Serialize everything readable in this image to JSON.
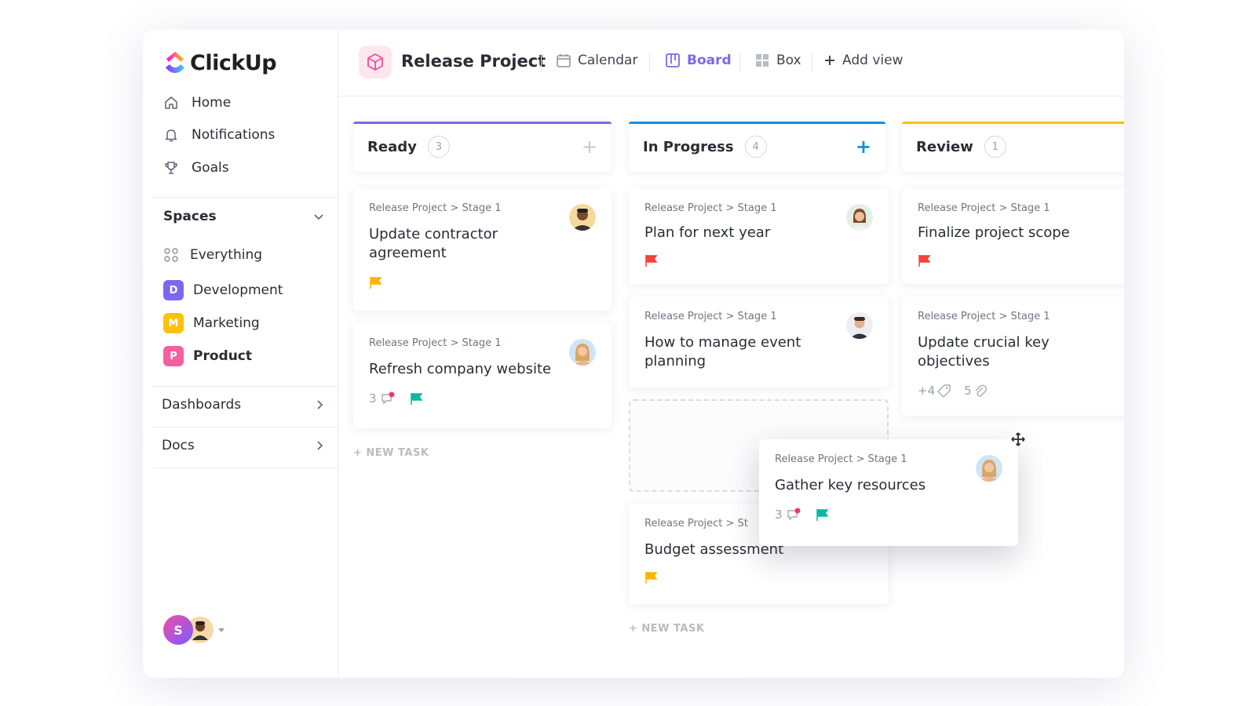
{
  "app": {
    "logo_text": "ClickUp"
  },
  "sidebar": {
    "nav": [
      {
        "label": "Home",
        "icon": "home-icon"
      },
      {
        "label": "Notifications",
        "icon": "bell-icon"
      },
      {
        "label": "Goals",
        "icon": "trophy-icon"
      }
    ],
    "spaces_label": "Spaces",
    "everything_label": "Everything",
    "spaces": [
      {
        "letter": "D",
        "label": "Development",
        "color": "#7b68ee"
      },
      {
        "letter": "M",
        "label": "Marketing",
        "color": "#ffc107"
      },
      {
        "letter": "P",
        "label": "Product",
        "color": "#f45fa0"
      }
    ],
    "dashboards_label": "Dashboards",
    "docs_label": "Docs",
    "user_initial": "S"
  },
  "topbar": {
    "project_title": "Release Project",
    "views": [
      {
        "label": "Calendar",
        "icon": "calendar-icon",
        "active": false
      },
      {
        "label": "Board",
        "icon": "board-icon",
        "active": true
      },
      {
        "label": "Box",
        "icon": "box-icon",
        "active": false
      }
    ],
    "add_view_label": "Add view"
  },
  "columns": [
    {
      "title": "Ready",
      "count": "3",
      "color": "#7b68ee"
    },
    {
      "title": "In Progress",
      "count": "4",
      "color": "#1090e0"
    },
    {
      "title": "Review",
      "count": "1",
      "color": "#ffc107"
    }
  ],
  "cards": {
    "ready": [
      {
        "path": "Release Project > Stage 1",
        "title": "Update contractor agreement",
        "flag": "#ffb300"
      },
      {
        "path": "Release Project > Stage 1",
        "title": "Refresh company website",
        "comments": "3",
        "flag": "#0fb5a6"
      }
    ],
    "in_progress": [
      {
        "path": "Release Project > Stage 1",
        "title": "Plan for next year",
        "flag": "#f44336"
      },
      {
        "path": "Release Project > Stage 1",
        "title": "How to manage event planning"
      },
      {
        "path": "Release Project > St",
        "title": "Budget assessment",
        "flag": "#ffb300"
      }
    ],
    "review": [
      {
        "path": "Release Project > Stage 1",
        "title": "Finalize project scope",
        "flag": "#f44336"
      },
      {
        "path": "Release Project > Stage 1",
        "title": "Update crucial key objectives",
        "tags": "+4",
        "attachments": "5"
      }
    ],
    "dragging": {
      "path": "Release Project > Stage 1",
      "title": "Gather key resources",
      "comments": "3",
      "flag": "#0fb5a6"
    }
  },
  "new_task_label": "+ NEW TASK"
}
